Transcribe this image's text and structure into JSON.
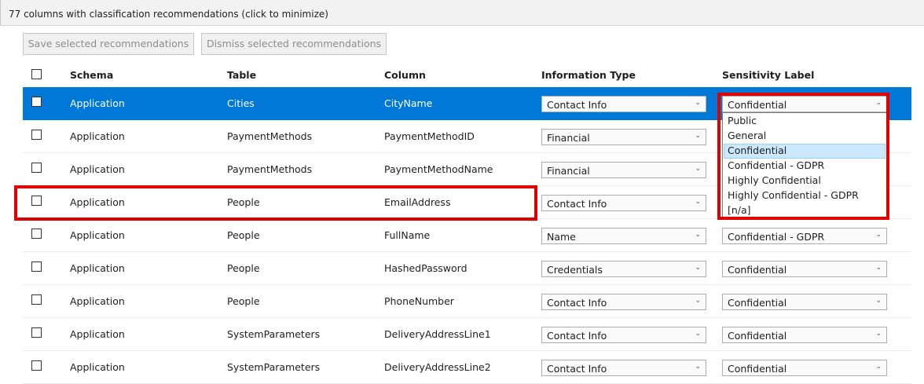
{
  "header": {
    "text": "77 columns with classification recommendations (click to minimize)"
  },
  "toolbar": {
    "save_label": "Save selected recommendations",
    "dismiss_label": "Dismiss selected recommendations"
  },
  "table": {
    "columns": {
      "schema": "Schema",
      "table": "Table",
      "column": "Column",
      "info_type": "Information Type",
      "sensitivity": "Sensitivity Label"
    },
    "rows": [
      {
        "schema": "Application",
        "table": "Cities",
        "column": "CityName",
        "info_type": "Contact Info",
        "sensitivity": "Confidential"
      },
      {
        "schema": "Application",
        "table": "PaymentMethods",
        "column": "PaymentMethodID",
        "info_type": "Financial",
        "sensitivity": ""
      },
      {
        "schema": "Application",
        "table": "PaymentMethods",
        "column": "PaymentMethodName",
        "info_type": "Financial",
        "sensitivity": ""
      },
      {
        "schema": "Application",
        "table": "People",
        "column": "EmailAddress",
        "info_type": "Contact Info",
        "sensitivity": ""
      },
      {
        "schema": "Application",
        "table": "People",
        "column": "FullName",
        "info_type": "Name",
        "sensitivity": "Confidential - GDPR"
      },
      {
        "schema": "Application",
        "table": "People",
        "column": "HashedPassword",
        "info_type": "Credentials",
        "sensitivity": "Confidential"
      },
      {
        "schema": "Application",
        "table": "People",
        "column": "PhoneNumber",
        "info_type": "Contact Info",
        "sensitivity": "Confidential"
      },
      {
        "schema": "Application",
        "table": "SystemParameters",
        "column": "DeliveryAddressLine1",
        "info_type": "Contact Info",
        "sensitivity": "Confidential"
      },
      {
        "schema": "Application",
        "table": "SystemParameters",
        "column": "DeliveryAddressLine2",
        "info_type": "Contact Info",
        "sensitivity": "Confidential"
      }
    ]
  },
  "dropdown": {
    "options": [
      "Public",
      "General",
      "Confidential",
      "Confidential - GDPR",
      "Highly Confidential",
      "Highly Confidential - GDPR",
      "[n/a]"
    ],
    "highlighted": "Confidential"
  },
  "icons": {
    "dropdown_arrow": "chevron-down-icon"
  },
  "colors": {
    "selected_row": "#0078d7",
    "highlight_box": "#e00000",
    "dropdown_hover": "#cce8ff"
  }
}
